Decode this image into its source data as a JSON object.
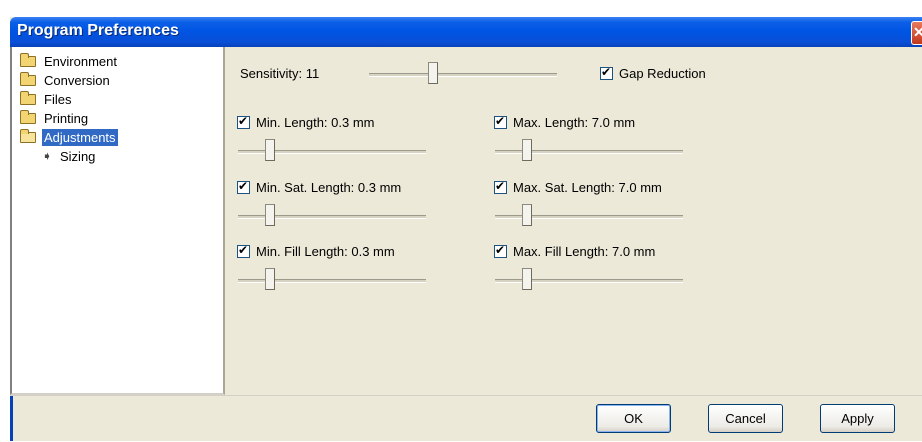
{
  "window": {
    "title": "Program Preferences",
    "close_glyph": "✕"
  },
  "tree": {
    "items": [
      {
        "label": "Environment",
        "icon": "folder-icon",
        "selected": false
      },
      {
        "label": "Conversion",
        "icon": "folder-icon",
        "selected": false
      },
      {
        "label": "Files",
        "icon": "folder-icon",
        "selected": false
      },
      {
        "label": "Printing",
        "icon": "folder-icon",
        "selected": false
      },
      {
        "label": "Adjustments",
        "icon": "folder-open-icon",
        "selected": true
      },
      {
        "label": "Sizing",
        "icon": "arrow-right-icon",
        "selected": false
      }
    ]
  },
  "settings": {
    "sensitivity": {
      "label": "Sensitivity: 11",
      "level": 0.33
    },
    "gap_reduction": {
      "label": "Gap Reduction",
      "checked": true
    },
    "min_length": {
      "label": "Min. Length: 0.3 mm",
      "checked": true,
      "level": 0.15
    },
    "max_length": {
      "label": "Max. Length: 7.0 mm",
      "checked": true,
      "level": 0.15
    },
    "min_sat_length": {
      "label": "Min. Sat. Length: 0.3 mm",
      "checked": true,
      "level": 0.15
    },
    "max_sat_length": {
      "label": "Max. Sat. Length: 7.0 mm",
      "checked": true,
      "level": 0.15
    },
    "min_fill_length": {
      "label": "Min. Fill Length: 0.3 mm",
      "checked": true,
      "level": 0.15
    },
    "max_fill_length": {
      "label": "Max. Fill Length: 7.0 mm",
      "checked": true,
      "level": 0.15
    }
  },
  "buttons": {
    "ok": "OK",
    "cancel": "Cancel",
    "apply": "Apply"
  },
  "colors": {
    "titlebar": "#0054e3",
    "selection": "#316ac5",
    "dialog_bg": "#ece9d8"
  }
}
